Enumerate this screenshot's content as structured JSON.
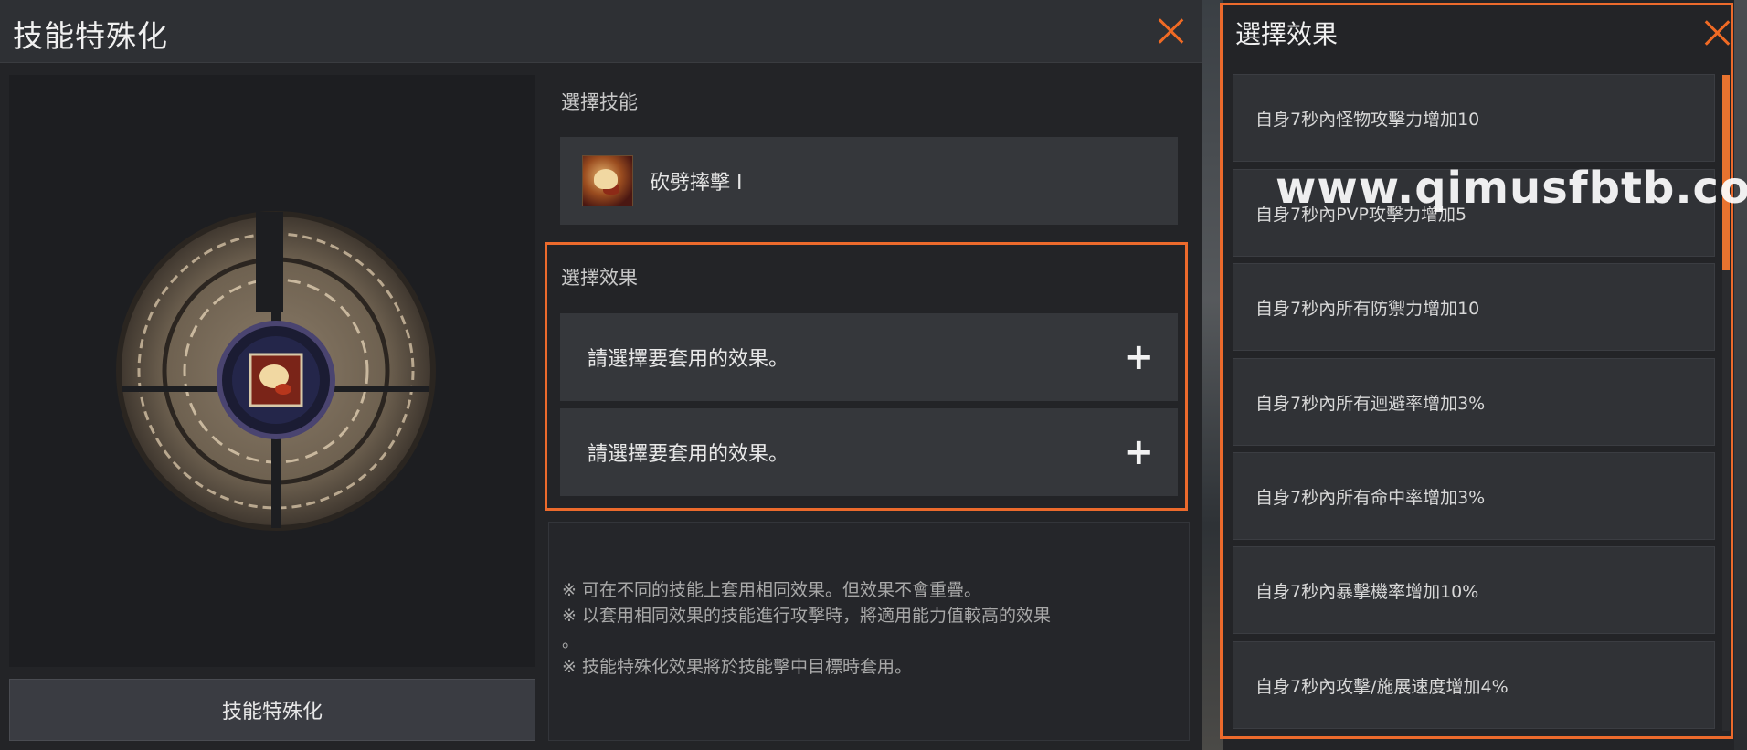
{
  "main_window": {
    "title": "技能特殊化",
    "primary_button": "技能特殊化",
    "select_skill_label": "選擇技能",
    "skill_name": "砍劈摔擊 I",
    "select_effect_label": "選擇效果",
    "slots": [
      "請選擇要套用的效果。",
      "請選擇要套用的效果。"
    ],
    "slot_add_symbol": "+",
    "notes": [
      "※ 可在不同的技能上套用相同效果。但效果不會重疊。",
      "※ 以套用相同效果的技能進行攻擊時，將適用能力值較高的效果",
      "。",
      "※ 技能特殊化效果將於技能擊中目標時套用。"
    ]
  },
  "effect_window": {
    "title": "選擇效果",
    "options": [
      "自身7秒內怪物攻擊力增加10",
      "自身7秒內PVP攻擊力增加5",
      "自身7秒內所有防禦力增加10",
      "自身7秒內所有迴避率增加3%",
      "自身7秒內所有命中率增加3%",
      "自身7秒內暴擊機率增加10%",
      "自身7秒內攻擊/施展速度增加4%"
    ]
  },
  "watermark": "www.qimusfbtb.com",
  "icons": {
    "close": "close-icon",
    "skill": "skill-icon",
    "emblem": "specialization-emblem-icon",
    "add": "plus-icon"
  },
  "colors": {
    "accent": "#ec6a2c",
    "panel": "#35373b",
    "window": "#232427"
  }
}
